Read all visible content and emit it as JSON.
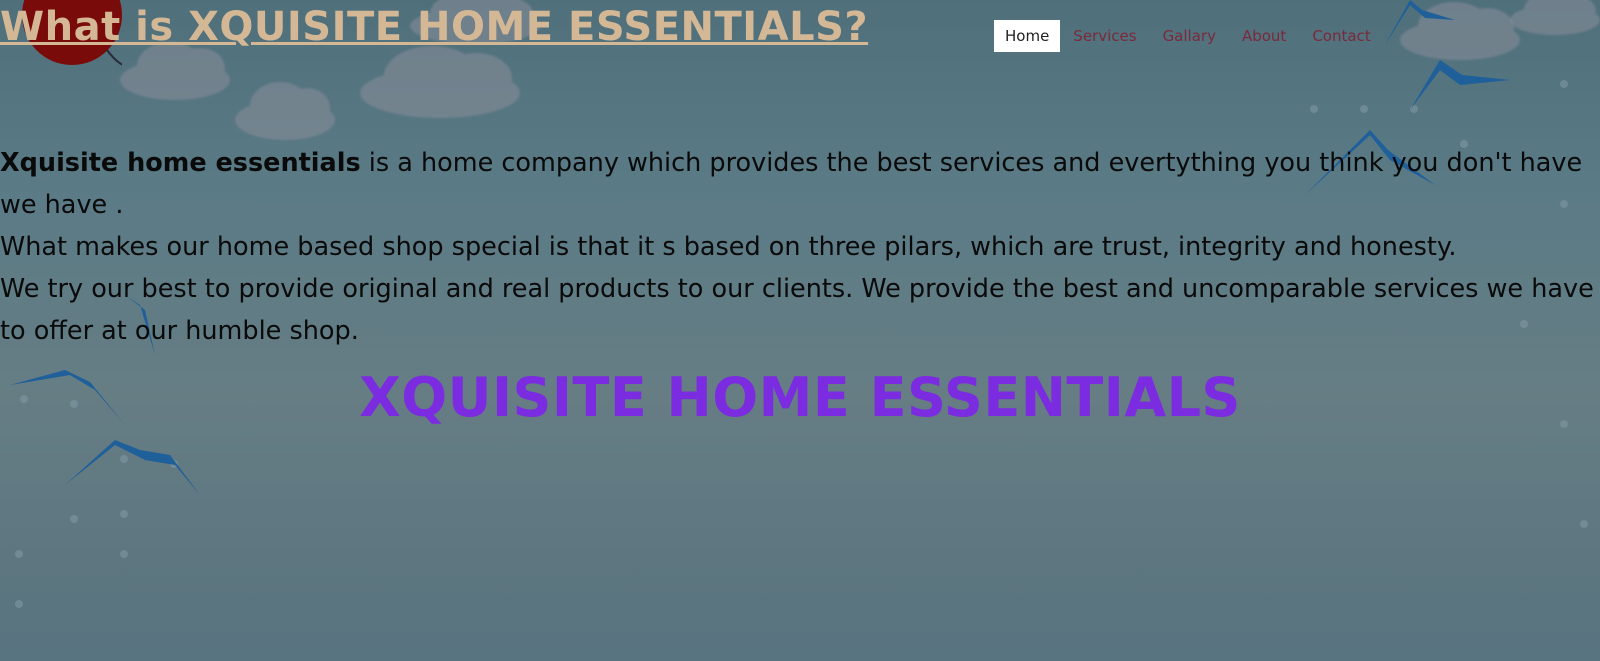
{
  "header": {
    "title": "What is XQUISITE HOME ESSENTIALS?"
  },
  "nav": {
    "items": [
      {
        "label": "Home",
        "active": true
      },
      {
        "label": "Services",
        "active": false
      },
      {
        "label": "Gallary",
        "active": false
      },
      {
        "label": "About",
        "active": false
      },
      {
        "label": "Contact",
        "active": false
      }
    ]
  },
  "intro": {
    "bold_lead": "Xquisite home essentials",
    "sentence_1": " is a home company which provides the best services and evertything you think you don't have we have .",
    "sentence_2": "What makes our home based shop special is that it s based on three pilars, which are trust, integrity and honesty.",
    "sentence_3": "We try our best to provide original and real products to our clients. We provide the best and uncomparable services we have to offer at our humble shop."
  },
  "banner": {
    "text": "XQUISITE HOME ESSENTIALS"
  },
  "colors": {
    "title": "#d4b896",
    "banner": "#7b2be0",
    "nav_link": "#7a2a3a",
    "nav_active_bg": "#ffffff"
  },
  "icons": [
    "balloon-icon",
    "bird-icon",
    "cloud-icon"
  ]
}
